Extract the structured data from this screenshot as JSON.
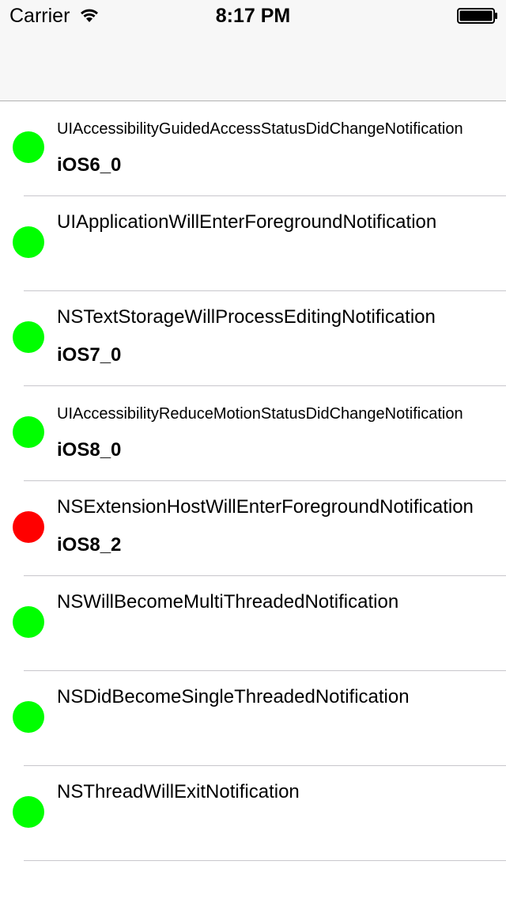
{
  "status_bar": {
    "carrier": "Carrier",
    "time": "8:17 PM",
    "wifi_icon": "wifi-icon",
    "battery_icon": "battery-icon"
  },
  "colors": {
    "ok": "#00ff00",
    "error": "#ff0000"
  },
  "rows": [
    {
      "title": "UIAccessibilityGuidedAccessStatusDidChangeNotification",
      "subtitle": "iOS6_0",
      "status": "ok"
    },
    {
      "title": "UIApplicationWillEnterForegroundNotification",
      "subtitle": "",
      "status": "ok"
    },
    {
      "title": "NSTextStorageWillProcessEditingNotification",
      "subtitle": "iOS7_0",
      "status": "ok"
    },
    {
      "title": "UIAccessibilityReduceMotionStatusDidChangeNotification",
      "subtitle": "iOS8_0",
      "status": "ok"
    },
    {
      "title": "NSExtensionHostWillEnterForegroundNotification",
      "subtitle": "iOS8_2",
      "status": "error"
    },
    {
      "title": "NSWillBecomeMultiThreadedNotification",
      "subtitle": "",
      "status": "ok"
    },
    {
      "title": "NSDidBecomeSingleThreadedNotification",
      "subtitle": "",
      "status": "ok"
    },
    {
      "title": "NSThreadWillExitNotification",
      "subtitle": "",
      "status": "ok"
    }
  ]
}
